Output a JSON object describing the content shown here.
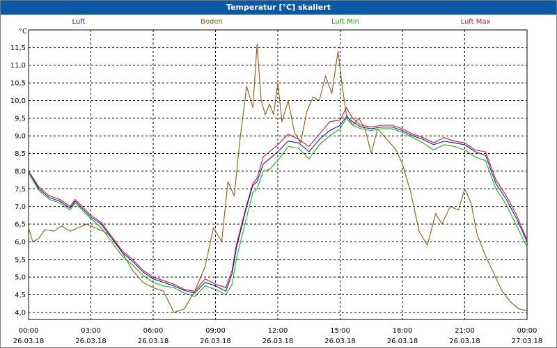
{
  "window": {
    "title": "Temperatur [°C] skaliert"
  },
  "colors": {
    "titlebar": "#0b58a4",
    "grid": "#000000"
  },
  "chart_data": {
    "type": "line",
    "title": "Temperatur [°C] skaliert",
    "y_unit": "°C",
    "ylim": [
      3.8,
      12.0
    ],
    "y_ticks": [
      "4,0",
      "4,5",
      "5,0",
      "5,5",
      "6,0",
      "6,5",
      "7,0",
      "7,5",
      "8,0",
      "8,5",
      "9,0",
      "9,5",
      "10,0",
      "10,5",
      "11,0",
      "11,5"
    ],
    "x_range_hours": [
      0,
      24
    ],
    "x_ticks": [
      {
        "time": "00:00",
        "date": "26.03.18"
      },
      {
        "time": "03:00",
        "date": "26.03.18"
      },
      {
        "time": "06:00",
        "date": "26.03.18"
      },
      {
        "time": "09:00",
        "date": "26.03.18"
      },
      {
        "time": "12:00",
        "date": "26.03.18"
      },
      {
        "time": "15:00",
        "date": "26.03.18"
      },
      {
        "time": "18:00",
        "date": "26.03.18"
      },
      {
        "time": "21:00",
        "date": "26.03.18"
      },
      {
        "time": "00:00",
        "date": "27.03.18"
      }
    ],
    "grid": true,
    "legend_position": "top",
    "series": [
      {
        "name": "Luft",
        "color": "#1a1ab4",
        "x": [
          0,
          0.5,
          1,
          1.5,
          2,
          2.25,
          2.5,
          3,
          3.5,
          4,
          4.5,
          5,
          5.5,
          6,
          6.5,
          7,
          7.5,
          8,
          8.5,
          9,
          9.5,
          9.8,
          10,
          10.5,
          10.8,
          11,
          11.3,
          11.6,
          12,
          12.5,
          13,
          13.5,
          14,
          14.5,
          15,
          15.3,
          15.6,
          16,
          16.5,
          17,
          17.5,
          18,
          18.5,
          19,
          19.5,
          20,
          20.5,
          21,
          21.5,
          22,
          22.5,
          23,
          23.5,
          24
        ],
        "values": [
          8.0,
          7.5,
          7.25,
          7.15,
          6.95,
          7.15,
          7.0,
          6.7,
          6.5,
          6.1,
          5.7,
          5.45,
          5.15,
          4.95,
          4.85,
          4.75,
          4.62,
          4.55,
          4.85,
          4.75,
          4.6,
          5.1,
          5.8,
          7.0,
          7.6,
          7.7,
          8.2,
          8.35,
          8.55,
          8.85,
          8.8,
          8.55,
          8.9,
          9.15,
          9.3,
          9.55,
          9.4,
          9.25,
          9.2,
          9.25,
          9.25,
          9.15,
          9.0,
          8.9,
          8.75,
          8.85,
          8.8,
          8.75,
          8.55,
          8.45,
          7.65,
          7.2,
          6.65,
          6.0
        ]
      },
      {
        "name": "Boden",
        "color": "#8b5a14",
        "x": [
          0,
          0.2,
          0.5,
          0.8,
          1.2,
          1.6,
          2.0,
          2.4,
          2.8,
          3.2,
          3.6,
          4.0,
          4.5,
          5.0,
          5.5,
          6.0,
          6.5,
          7.0,
          7.5,
          8.0,
          8.5,
          8.9,
          9.3,
          9.6,
          9.9,
          10.2,
          10.5,
          10.8,
          11.0,
          11.2,
          11.4,
          11.6,
          11.8,
          12.0,
          12.2,
          12.5,
          12.8,
          13.1,
          13.4,
          13.7,
          14.0,
          14.3,
          14.6,
          14.9,
          15.1,
          15.3,
          15.6,
          15.9,
          16.2,
          16.5,
          16.8,
          17.1,
          17.4,
          17.7,
          18.0,
          18.4,
          18.8,
          19.2,
          19.6,
          19.9,
          20.3,
          20.7,
          21.0,
          21.3,
          21.6,
          22.0,
          22.4,
          22.8,
          23.2,
          23.6,
          24.0
        ],
        "values": [
          6.4,
          6.0,
          6.1,
          6.35,
          6.3,
          6.45,
          6.3,
          6.4,
          6.5,
          6.4,
          6.3,
          6.15,
          5.7,
          5.2,
          4.85,
          4.7,
          4.6,
          4.0,
          4.1,
          4.6,
          5.3,
          6.4,
          6.0,
          7.7,
          7.3,
          9.0,
          10.4,
          9.8,
          11.6,
          10.0,
          9.6,
          9.9,
          9.6,
          10.5,
          9.4,
          10.0,
          9.1,
          8.8,
          9.7,
          10.1,
          10.0,
          10.7,
          10.2,
          11.4,
          10.4,
          9.6,
          9.3,
          9.5,
          9.2,
          8.5,
          9.2,
          9.0,
          8.8,
          8.6,
          8.2,
          7.4,
          6.3,
          5.9,
          6.8,
          6.5,
          7.0,
          6.9,
          7.5,
          7.1,
          6.2,
          5.6,
          5.1,
          4.6,
          4.3,
          4.1,
          4.05
        ]
      },
      {
        "name": "Luft Min",
        "color": "#12b412",
        "x": [
          0,
          0.5,
          1,
          1.5,
          2,
          2.25,
          2.5,
          3,
          3.5,
          4,
          4.5,
          5,
          5.5,
          6,
          6.5,
          7,
          7.5,
          8,
          8.5,
          9,
          9.5,
          9.8,
          10,
          10.5,
          10.8,
          11,
          11.3,
          11.6,
          12,
          12.5,
          13,
          13.5,
          14,
          14.5,
          15,
          15.3,
          15.6,
          16,
          16.5,
          17,
          17.5,
          18,
          18.5,
          19,
          19.5,
          20,
          20.5,
          21,
          21.5,
          22,
          22.5,
          23,
          23.5,
          24
        ],
        "values": [
          7.95,
          7.45,
          7.2,
          7.1,
          6.9,
          7.1,
          6.95,
          6.65,
          6.4,
          6.0,
          5.6,
          5.35,
          5.05,
          4.85,
          4.75,
          4.7,
          4.55,
          4.45,
          4.75,
          4.65,
          4.5,
          4.8,
          5.5,
          6.7,
          7.4,
          7.5,
          8.0,
          8.05,
          8.3,
          8.7,
          8.65,
          8.35,
          8.75,
          9.0,
          9.2,
          9.5,
          9.3,
          9.2,
          9.15,
          9.2,
          9.2,
          9.1,
          8.95,
          8.8,
          8.6,
          8.75,
          8.7,
          8.6,
          8.4,
          8.3,
          7.5,
          7.05,
          6.45,
          5.85
        ]
      },
      {
        "name": "Luft Max",
        "color": "#c81428",
        "x": [
          0,
          0.5,
          1,
          1.5,
          2,
          2.25,
          2.5,
          3,
          3.5,
          4,
          4.5,
          5,
          5.5,
          6,
          6.5,
          7,
          7.5,
          8,
          8.5,
          9,
          9.5,
          9.8,
          10,
          10.5,
          10.8,
          11,
          11.3,
          11.6,
          12,
          12.5,
          13,
          13.5,
          14,
          14.5,
          15,
          15.3,
          15.6,
          16,
          16.5,
          17,
          17.5,
          18,
          18.5,
          19,
          19.5,
          20,
          20.5,
          21,
          21.5,
          22,
          22.5,
          23,
          23.5,
          24
        ],
        "values": [
          8.0,
          7.55,
          7.3,
          7.2,
          7.0,
          7.2,
          7.05,
          6.75,
          6.55,
          6.15,
          5.75,
          5.5,
          5.2,
          5.0,
          4.9,
          4.8,
          4.65,
          4.6,
          4.95,
          4.8,
          4.7,
          5.2,
          5.9,
          7.05,
          7.65,
          7.8,
          8.4,
          8.55,
          8.75,
          9.05,
          8.9,
          8.7,
          9.05,
          9.4,
          9.45,
          9.8,
          9.5,
          9.3,
          9.25,
          9.3,
          9.3,
          9.2,
          9.05,
          8.95,
          8.8,
          8.95,
          8.85,
          8.8,
          8.6,
          8.55,
          7.75,
          7.3,
          6.75,
          6.05
        ]
      }
    ]
  }
}
